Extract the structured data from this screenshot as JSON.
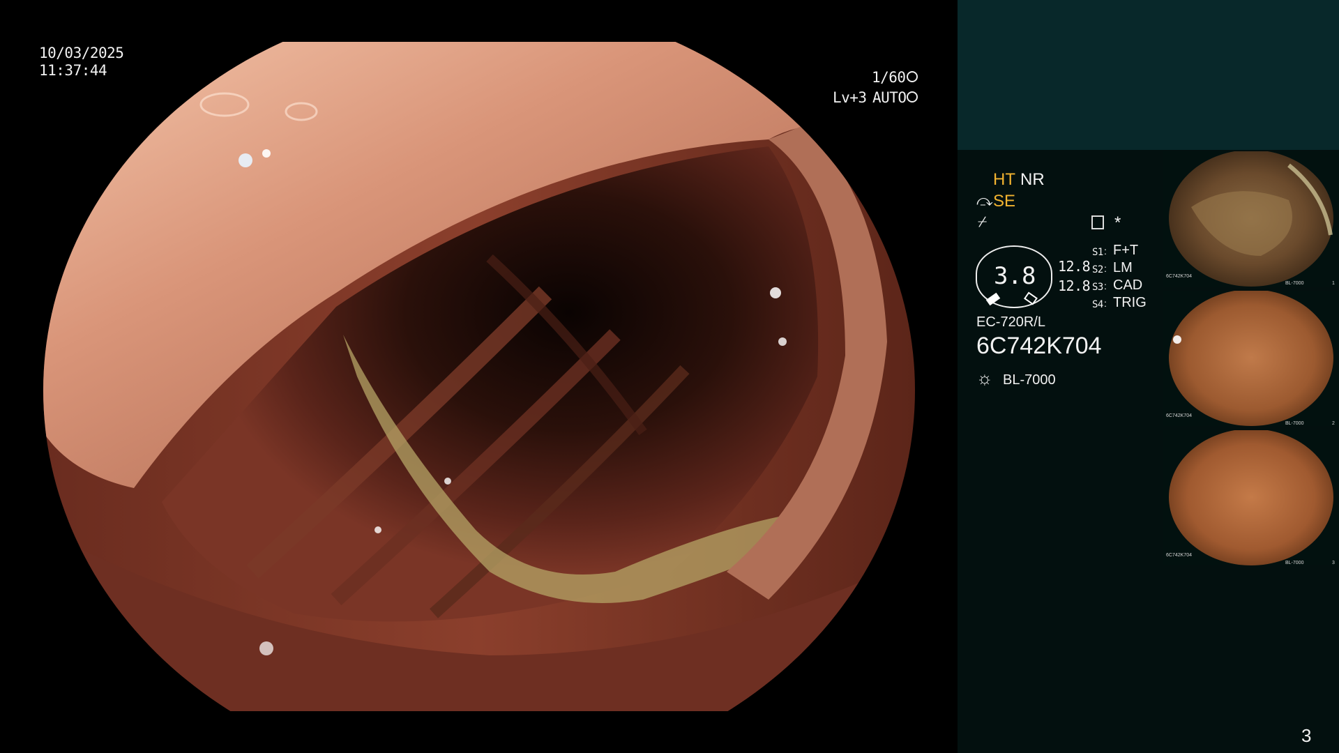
{
  "overlay": {
    "date": "10/03/2025",
    "time": "11:37:44",
    "shutter": "1/60",
    "level": "Lv+3",
    "mode": "AUTO"
  },
  "panel": {
    "ht": "HT",
    "nr": "NR",
    "se": "SE",
    "asterisk": "*",
    "dial_value": "3.8",
    "readout_1": "12.8",
    "readout_2": "12.8",
    "switches": [
      {
        "key": "S1",
        "value": "F+T"
      },
      {
        "key": "S2",
        "value": "LM"
      },
      {
        "key": "S3",
        "value": "CAD"
      },
      {
        "key": "S4",
        "value": "TRIG"
      }
    ],
    "scope_model": "EC-720R/L",
    "serial": "6C742K704",
    "light_source": "BL-7000",
    "page_number": "3"
  },
  "thumbnails": [
    {
      "index": "1",
      "serial": "6C742K704",
      "light": "BL-7000"
    },
    {
      "index": "2",
      "serial": "6C742K704",
      "light": "BL-7000"
    },
    {
      "index": "3",
      "serial": "6C742K704",
      "light": "BL-7000"
    }
  ],
  "colors": {
    "panel_top": "#08282a",
    "panel_bottom": "#03100f",
    "accent_yellow": "#f3b430",
    "mucosa": "#c9876a",
    "lumen": "#1a0906"
  }
}
